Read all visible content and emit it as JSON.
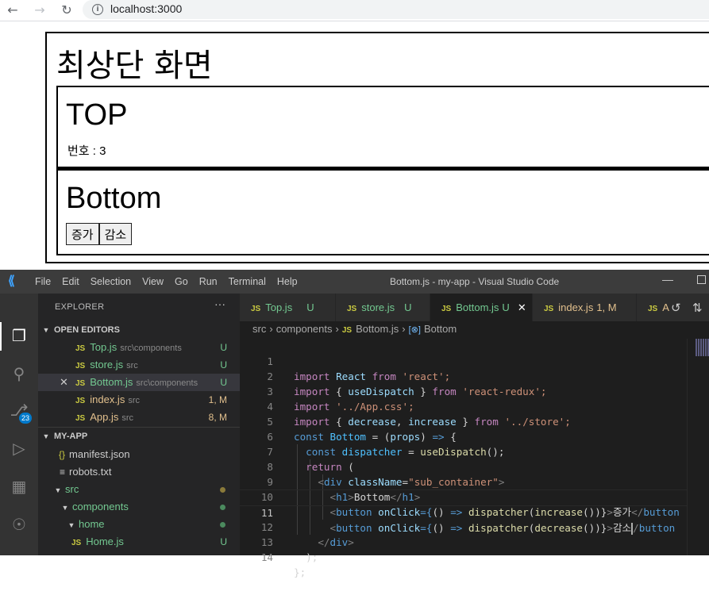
{
  "browser": {
    "url": "localhost:3000"
  },
  "page": {
    "main_title": "최상단 화면",
    "top": {
      "heading": "TOP",
      "number_text": "번호 : 3"
    },
    "bottom": {
      "heading": "Bottom",
      "increase_label": "증가",
      "decrease_label": "감소"
    }
  },
  "vscode": {
    "menu": [
      "File",
      "Edit",
      "Selection",
      "View",
      "Go",
      "Run",
      "Terminal",
      "Help"
    ],
    "window_title": "Bottom.js - my-app - Visual Studio Code",
    "scm_badge": "23",
    "explorer": {
      "title": "EXPLORER",
      "open_editors_label": "OPEN EDITORS",
      "open_editors": [
        {
          "name": "Top.js",
          "path": "src\\components",
          "status": "U"
        },
        {
          "name": "store.js",
          "path": "src",
          "status": "U"
        },
        {
          "name": "Bottom.js",
          "path": "src\\components",
          "status": "U"
        },
        {
          "name": "index.js",
          "path": "src",
          "status": "1, M"
        },
        {
          "name": "App.js",
          "path": "src",
          "status": "8, M"
        }
      ],
      "project_label": "MY-APP",
      "tree": {
        "manifest": "manifest.json",
        "robots": "robots.txt",
        "src": "src",
        "components": "components",
        "home": "home",
        "home_js": "Home.js",
        "home_js_status": "U"
      }
    },
    "tabs": [
      {
        "label": "Top.js",
        "status": "U"
      },
      {
        "label": "store.js",
        "status": "U"
      },
      {
        "label": "Bottom.js",
        "status": "U"
      },
      {
        "label": "index.js",
        "status": "1, M"
      },
      {
        "label": "A",
        "status": ""
      }
    ],
    "breadcrumb": {
      "src": "src",
      "components": "components",
      "file": "Bottom.js",
      "symbol": "Bottom"
    },
    "line_numbers": [
      "1",
      "2",
      "3",
      "4",
      "5",
      "6",
      "7",
      "8",
      "9",
      "10",
      "11",
      "12",
      "13",
      "14"
    ],
    "code": {
      "l1": {
        "k1": "import",
        "v1": " React ",
        "k2": "from",
        "s1": " 'react';"
      },
      "l2": {
        "k1": "import",
        "p1": " { ",
        "v1": "useDispatch",
        "p2": " } ",
        "k2": "from",
        "s1": " 'react-redux';"
      },
      "l3": {
        "k1": "import",
        "s1": " '../App.css';"
      },
      "l4": {
        "k1": "import",
        "p1": " { ",
        "v1": "decrease",
        "p2": ", ",
        "v2": "increase",
        "p3": " } ",
        "k2": "from",
        "s1": " '../store';"
      },
      "l5": {
        "k1": "const",
        "c1": " Bottom",
        "p1": " = (",
        "v1": "props",
        "p2": ") ",
        "k2": "=>",
        "p3": " {"
      },
      "l6": {
        "k1": "const",
        "c1": " dispatcher",
        "p1": " = ",
        "f1": "useDispatch",
        "p2": "();"
      },
      "l7": {
        "k1": "return",
        "p1": " ("
      },
      "l8": {
        "t1": "<",
        "tag": "div",
        "a1": " className",
        "p1": "=",
        "s1": "\"sub_container\"",
        "t2": ">"
      },
      "l9": {
        "t1": "<",
        "tag": "h1",
        "t2": ">",
        "txt": "Bottom",
        "t3": "</",
        "tag2": "h1",
        "t4": ">"
      },
      "l10": {
        "t1": "<",
        "tag": "button",
        "a1": " onClick",
        "p1": "={",
        "p2": "() ",
        "k1": "=>",
        "f1": " dispatcher",
        "p3": "(",
        "f2": "increase",
        "p4": "())}",
        "t2": ">",
        "txt": "증가",
        "t3": "</",
        "tag2": "button"
      },
      "l11": {
        "t1": "<",
        "tag": "button",
        "a1": " onClick",
        "p1": "={",
        "p2": "() ",
        "k1": "=>",
        "f1": " dispatcher",
        "p3": "(",
        "f2": "decrease",
        "p4": "())}",
        "t2": ">",
        "txt1": "감소",
        "t3": "/",
        "tag2": "button"
      },
      "l12": {
        "t1": "</",
        "tag": "div",
        "t2": ">"
      },
      "l13": {
        "p1": ");"
      },
      "l14": {
        "p1": "};"
      }
    }
  },
  "colors": {
    "vscode_bg": "#1e1e1e",
    "sidebar_bg": "#252526",
    "titlebar_bg": "#3c3c3c",
    "git_untracked": "#73c991",
    "git_modified": "#e2c08d",
    "js_icon": "#cbcb41"
  }
}
